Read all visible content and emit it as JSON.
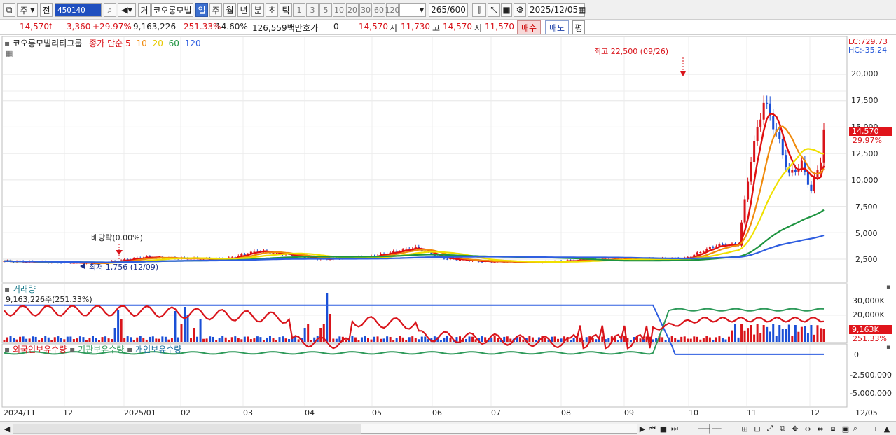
{
  "toolbar": {
    "type_label": "주",
    "all_label": "전",
    "code": "450140",
    "trade_label": "거",
    "stock_name": "코오롱모빌",
    "periods": [
      "일",
      "주",
      "월",
      "년",
      "분",
      "초",
      "틱"
    ],
    "selected_period": "일",
    "intervals": [
      "1",
      "3",
      "5",
      "10",
      "20",
      "30",
      "60",
      "120"
    ],
    "count": "265",
    "count_max": "/600",
    "date": "2025/12/05"
  },
  "quote": {
    "price": "14,570",
    "arrow": "↑",
    "change": "3,360",
    "change_rate": "+29.97%",
    "volume": "9,163,226",
    "volume_rate": "251.33%",
    "turnover": "14.60%",
    "amount": "126,559백만",
    "hoga_label": "호가",
    "hoga_value": "0",
    "hoga_price": "14,570",
    "open_label": "시",
    "open": "11,730",
    "high_label": "고",
    "high": "14,570",
    "low_label": "저",
    "low": "11,570",
    "buy_label": "매수",
    "sell_label": "매도",
    "eval_label": "평"
  },
  "price_panel": {
    "stock_title": "코오롱모빌리티그룹",
    "ma_label": "종가 단순",
    "ma_periods": [
      "5",
      "10",
      "20",
      "60",
      "120"
    ],
    "ma_colors": [
      "#e01010",
      "#f08a0c",
      "#f0e000",
      "#1e9440",
      "#2f5ee0"
    ],
    "lc": "LC:729.73",
    "hc": "HC:-35.24",
    "y_ticks": [
      "20,000",
      "17,500",
      "15,000",
      "12,500",
      "10,000",
      "7,500",
      "5,000",
      "2,500"
    ],
    "current_price_tag": "14,570",
    "current_rate_tag": "29.97%",
    "high_annotation": "최고 22,500 (09/26)",
    "low_annotation": "최저 1,756 (12/09)",
    "dividend_annotation": "배당락(0.00%)"
  },
  "volume_panel": {
    "title": "거래량",
    "value": "9,163,226주(251.33%)",
    "y_ticks": [
      "30,000K",
      "20,000K"
    ],
    "current_tag": "9,163K",
    "rate_tag": "251.33%"
  },
  "holding_panel": {
    "legend": [
      "외국인보유수량",
      "기관보유수량",
      "개인보유수량"
    ],
    "legend_colors": [
      "#d9141b",
      "#2e9a5a",
      "#2f5ee0"
    ],
    "y_ticks": [
      "0",
      "-2,500,000",
      "-5,000,000"
    ]
  },
  "x_axis": {
    "labels": [
      "2024/11",
      "12",
      "2025/01",
      "02",
      "03",
      "04",
      "05",
      "06",
      "07",
      "08",
      "09",
      "10",
      "11",
      "12",
      "12/05"
    ]
  },
  "chart_data": {
    "type": "line",
    "price_candles_close_approx": [
      2350,
      2300,
      2250,
      2400,
      2500,
      2700,
      2600,
      2550,
      2500,
      2450,
      2800,
      3200,
      2900,
      2600,
      2500,
      2400,
      2450,
      2500,
      2600,
      2450,
      2400,
      2380,
      2400,
      2450,
      2500,
      2600,
      2700,
      2800,
      2900,
      3300,
      3800,
      9000,
      13500,
      17500,
      12000,
      9800,
      11000,
      9500,
      8800,
      8000,
      8500,
      10500,
      12000,
      10500,
      9500,
      10500,
      11000,
      12000,
      11500,
      14570
    ],
    "ma_series": [
      "5",
      "10",
      "20",
      "60",
      "120"
    ]
  }
}
